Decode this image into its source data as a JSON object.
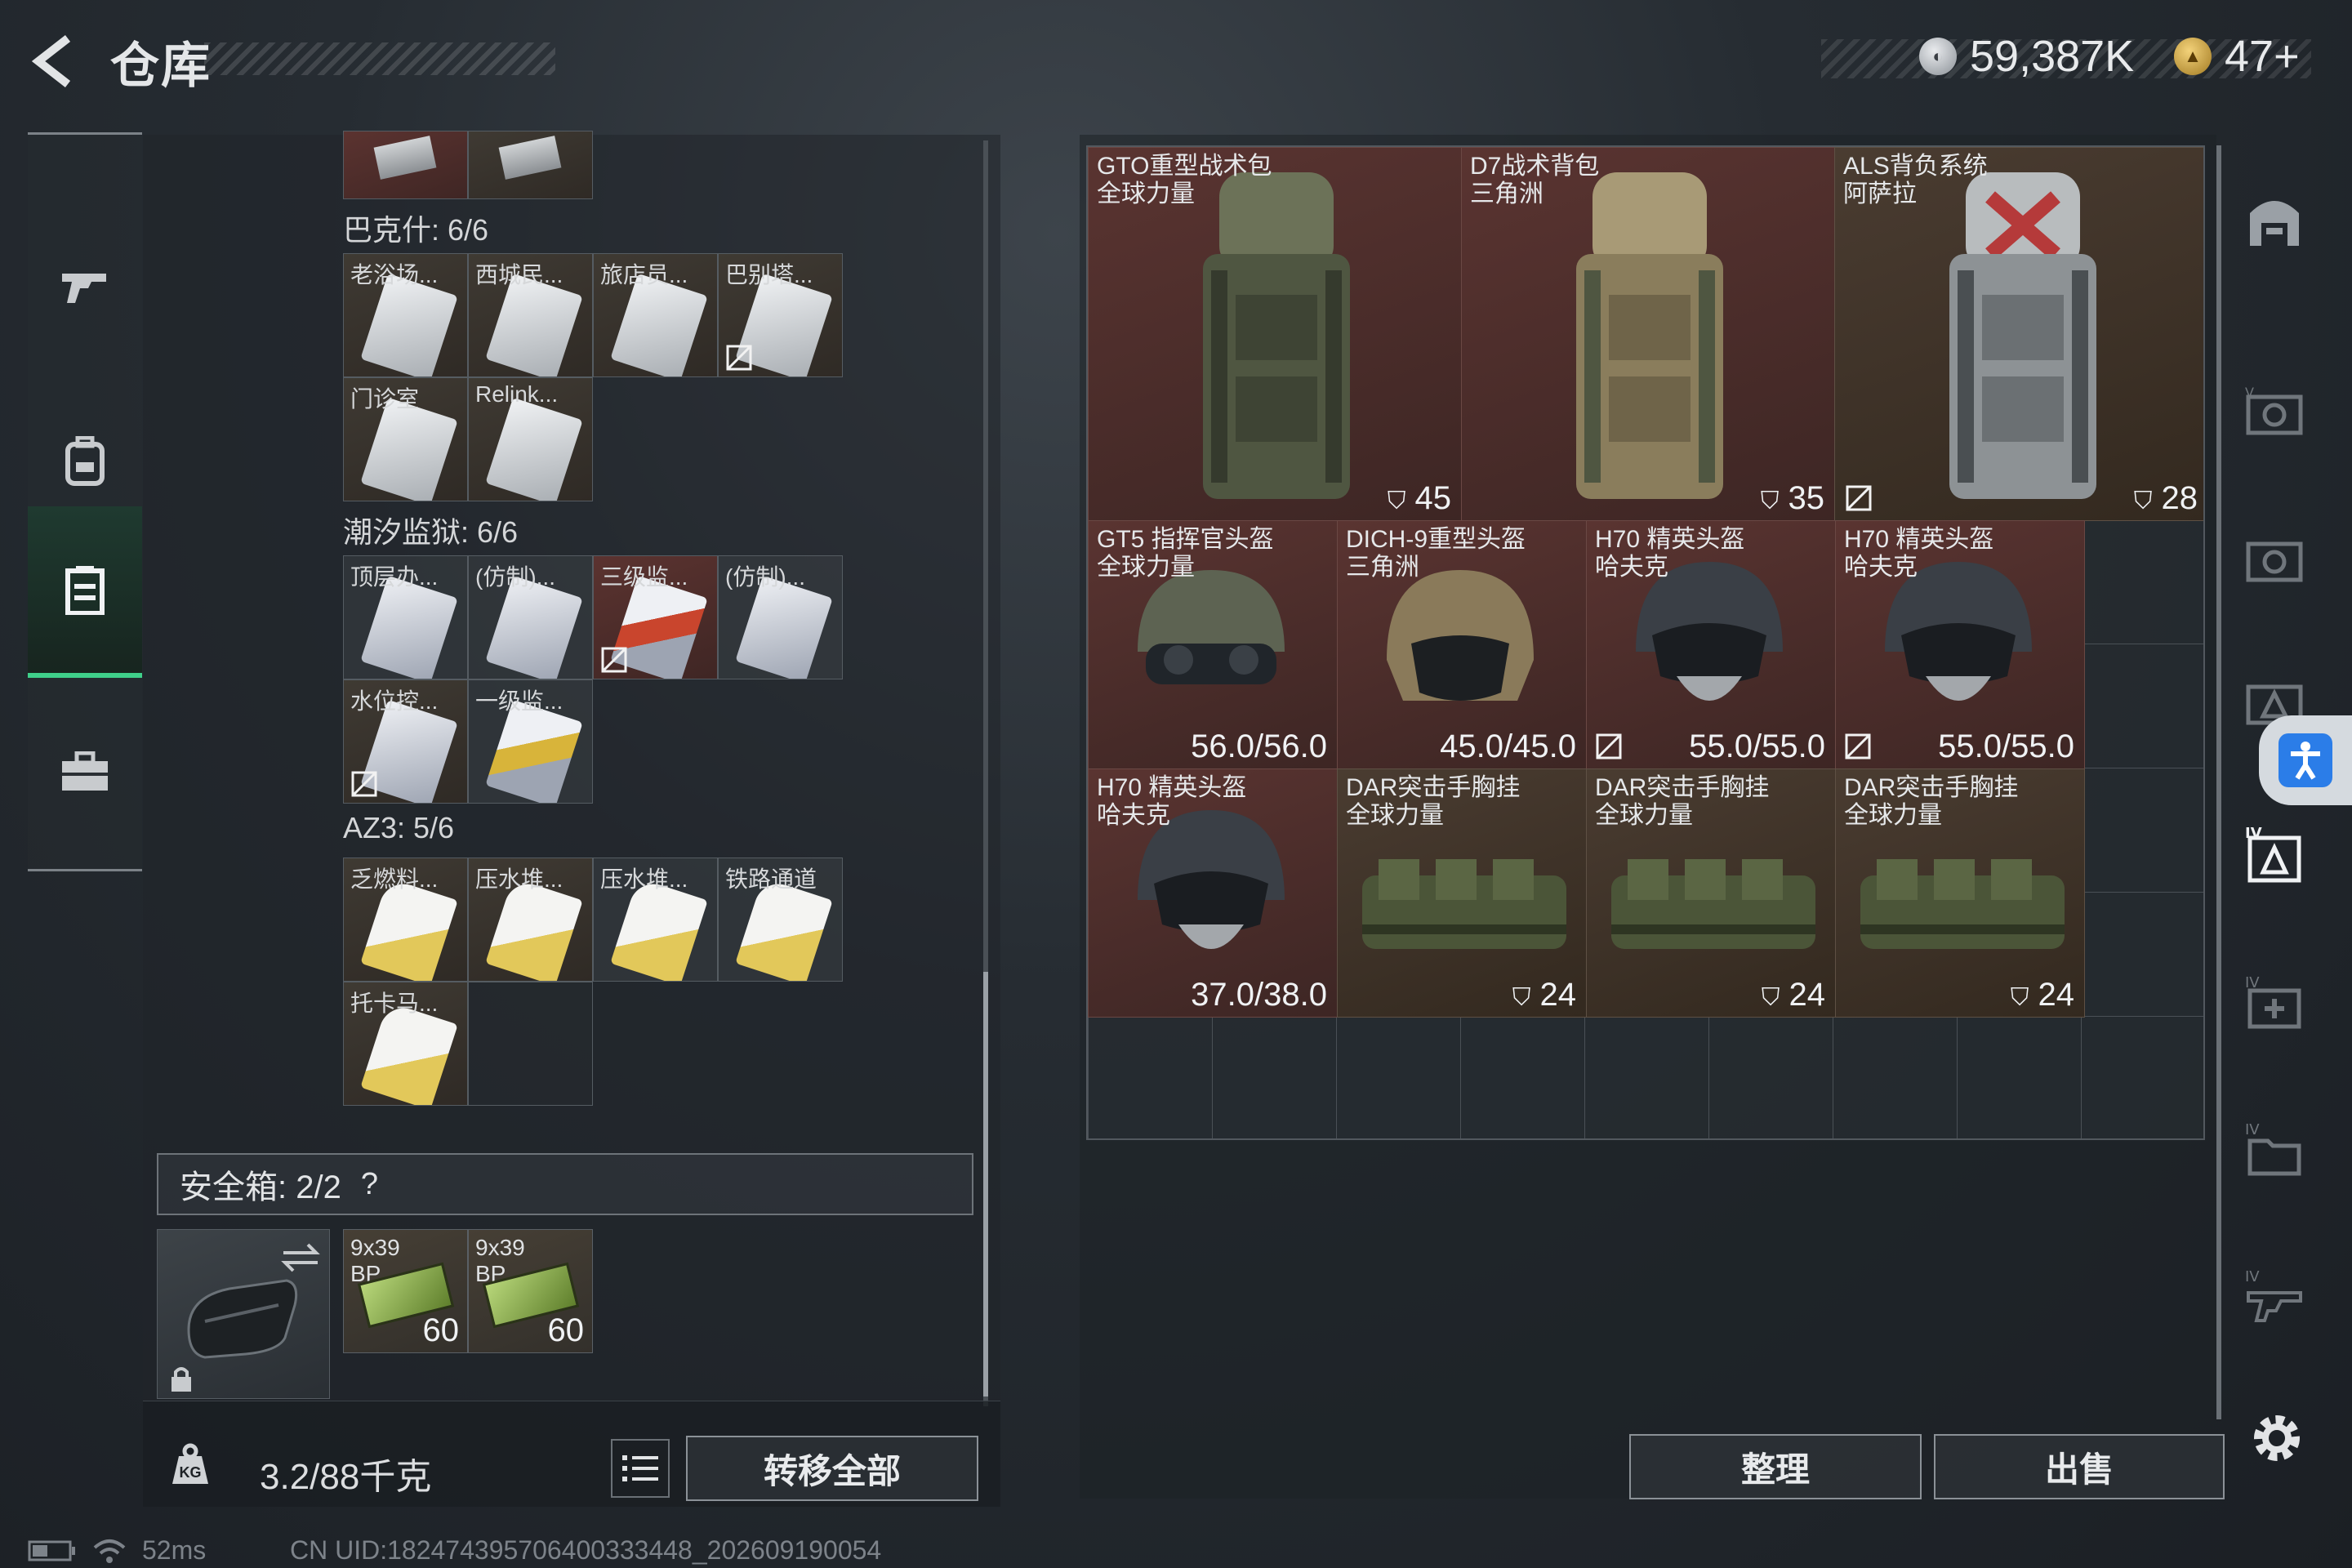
{
  "header": {
    "title": "仓库"
  },
  "currency": {
    "coins": "59,387K",
    "tickets": "47+"
  },
  "left_nav": [
    "weapons",
    "backpack",
    "stash",
    "toolbox"
  ],
  "sections": [
    {
      "name": "巴克什: 6/6",
      "items": [
        "老浴场...",
        "西城民...",
        "旅店员...",
        "巴别塔...",
        "门诊室",
        "Relink..."
      ]
    },
    {
      "name": "潮汐监狱: 6/6",
      "items": [
        "顶层办...",
        "(仿制)...",
        "三级监...",
        "(仿制)...",
        "水位控...",
        "一级监..."
      ]
    },
    {
      "name": "AZ3: 5/6",
      "items": [
        "乏燃料...",
        "压水堆...",
        "压水堆...",
        "铁路通道",
        "托卡马..."
      ]
    }
  ],
  "safe_box": {
    "label": "安全箱: 2/2",
    "help": "?",
    "ammo": [
      {
        "name": "9x39",
        "sub": "BP",
        "count": "60"
      },
      {
        "name": "9x39",
        "sub": "BP",
        "count": "60"
      }
    ]
  },
  "footer_left": {
    "weight": "3.2/88千克",
    "transfer_all": "转移全部",
    "ping": "52ms",
    "uid": "CN UID:182474395706400333448_202609190054"
  },
  "stash_items": [
    {
      "name": "GTO重型战术包",
      "sub": "全球力量",
      "value": "45"
    },
    {
      "name": "D7战术背包",
      "sub": "三角洲",
      "value": "35"
    },
    {
      "name": "ALS背负系统",
      "sub": "阿萨拉",
      "value": "28"
    },
    {
      "name": "GT5 指挥官头盔",
      "sub": "全球力量",
      "value": "56.0/56.0"
    },
    {
      "name": "DICH-9重型头盔",
      "sub": "三角洲",
      "value": "45.0/45.0"
    },
    {
      "name": "H70 精英头盔",
      "sub": "哈夫克",
      "value": "55.0/55.0"
    },
    {
      "name": "H70 精英头盔",
      "sub": "哈夫克",
      "value": "55.0/55.0"
    },
    {
      "name": "H70 精英头盔",
      "sub": "哈夫克",
      "value": "37.0/38.0"
    },
    {
      "name": "DAR突击手胸挂",
      "sub": "全球力量",
      "value": "24"
    },
    {
      "name": "DAR突击手胸挂",
      "sub": "全球力量",
      "value": "24"
    },
    {
      "name": "DAR突击手胸挂",
      "sub": "全球力量",
      "value": "24"
    }
  ],
  "actions": {
    "sort": "整理",
    "sell": "出售"
  },
  "colors": {
    "item_red": "#5a3431",
    "item_brown": "#4a3c31",
    "active_green": "#3fd08a",
    "access_blue": "#2b7de8"
  }
}
